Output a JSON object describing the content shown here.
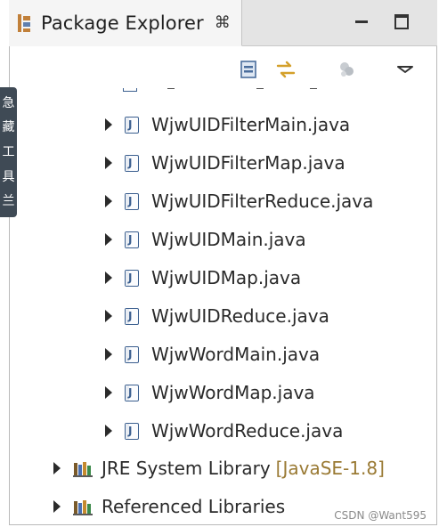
{
  "tab": {
    "title": "Package Explorer",
    "close_glyph": "⌘"
  },
  "window_controls": {
    "minimize_icon": "minimize-icon",
    "maximize_icon": "maximize-icon"
  },
  "toolbar": {
    "icons": [
      "collapse-all-icon",
      "link-with-editor-icon",
      "filter-icon",
      "view-menu-icon"
    ]
  },
  "side_tab": {
    "chars": [
      "急",
      "藏",
      "工",
      "具",
      "兰"
    ]
  },
  "tree": {
    "files": [
      "WjwUIDFilterMain.java",
      "WjwUIDFilterMap.java",
      "WjwUIDFilterReduce.java",
      "WjwUIDMain.java",
      "WjwUIDMap.java",
      "WjwUIDReduce.java",
      "WjwWordMain.java",
      "WjwWordMap.java",
      "WjwWordReduce.java"
    ],
    "libraries": [
      {
        "label": "JRE System Library",
        "suffix": "[JavaSE-1.8]"
      },
      {
        "label": "Referenced Libraries",
        "suffix": ""
      }
    ]
  },
  "watermark": "CSDN @Want595",
  "colors": {
    "java_icon": "#3b5f8f",
    "library_suffix": "#9a7a34",
    "side_tab": "#3f4a55"
  }
}
